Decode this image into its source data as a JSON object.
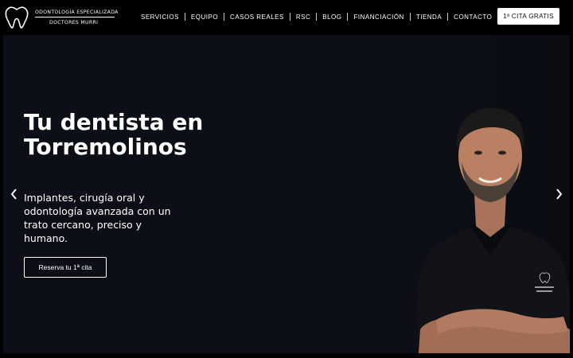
{
  "header": {
    "logo": {
      "line1": "ODONTOLOGÍA ESPECIALIZADA",
      "line2": "DOCTORES MURRI"
    },
    "nav": [
      {
        "label": "SERVICIOS"
      },
      {
        "label": "EQUIPO"
      },
      {
        "label": "CASOS REALES"
      },
      {
        "label": "RSC"
      },
      {
        "label": "BLOG"
      },
      {
        "label": "FINANCIACIÓN"
      },
      {
        "label": "TIENDA"
      },
      {
        "label": "CONTACTO"
      }
    ],
    "cta_label": "1ª CITA GRATIS"
  },
  "hero": {
    "title": "Tu dentista en Torremolinos",
    "subtitle": "Implantes, cirugía oral y odontología avanzada con un trato cercano, preciso y humano.",
    "button_label": "Reserva tu 1ª cita",
    "prev_icon": "chevron-left-icon",
    "next_icon": "chevron-right-icon"
  },
  "colors": {
    "header_bg": "#000000",
    "hero_bg": "#0c0f17",
    "cta_bg": "#ffffff",
    "text": "#ffffff"
  }
}
